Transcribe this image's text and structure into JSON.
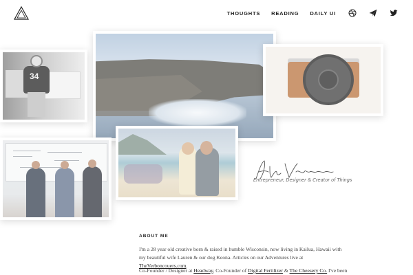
{
  "header": {
    "nav": [
      {
        "label": "THOUGHTS"
      },
      {
        "label": "READING"
      },
      {
        "label": "DAILY UI"
      }
    ],
    "icons": [
      "dribbble-icon",
      "paper-plane-icon",
      "twitter-icon"
    ]
  },
  "photos": {
    "football": {
      "jersey_number": "34"
    }
  },
  "signature": {
    "tagline": "Entrepreneur, Designer & Creator of Things"
  },
  "about": {
    "heading": "ABOUT ME",
    "intro_before_link": "I'm a 28 year old creative born & raised in humble Wisconsin, now living in Kailua, Hawaii with my beautiful wife Lauren & our dog Keona. Articles on our Adventures live at ",
    "intro_link": "TheVerboncouers.com",
    "intro_after_link": ".",
    "roles_prefix": "Co-Founder / Designer at ",
    "role_link_1": "Headway",
    "roles_mid_1": ", Co-Founder of ",
    "role_link_2": "Digital Fertilizer",
    "roles_mid_2": " & ",
    "role_link_3": "The Cheesery Co.",
    "roles_suffix": " I've been"
  },
  "colors": {
    "accent_text": "#222222",
    "body_text": "#444444",
    "background": "#ffffff"
  }
}
